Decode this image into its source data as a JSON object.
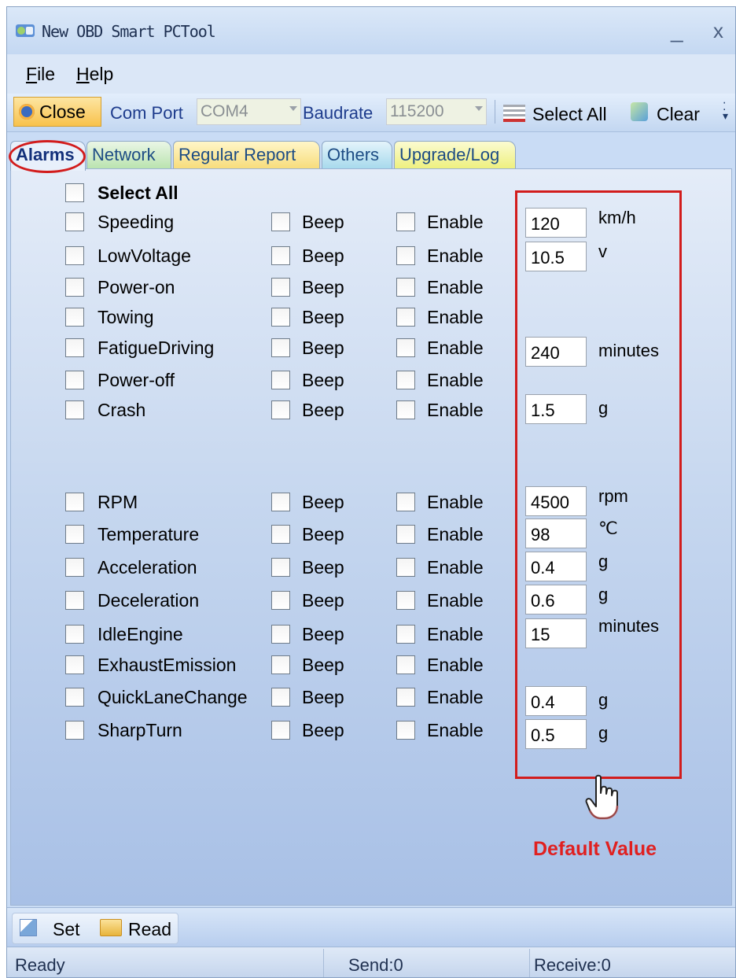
{
  "window": {
    "title": "New OBD Smart PCTool",
    "minimize": "_",
    "close": "x"
  },
  "menu": {
    "file_prefix": "F",
    "file_rest": "ile",
    "help_prefix": "H",
    "help_rest": "elp"
  },
  "toolbar": {
    "connect_label": "Close",
    "com_port_label": "Com Port",
    "com_port_value": "COM4",
    "baudrate_label": "Baudrate",
    "baudrate_value": "115200",
    "select_all_label": "Select All",
    "clear_label": "Clear"
  },
  "tabs": [
    "Alarms",
    "Network",
    "Regular Report",
    "Others",
    "Upgrade/Log"
  ],
  "alarms": {
    "select_all": "Select All",
    "beep_label": "Beep",
    "enable_label": "Enable",
    "items": [
      {
        "name": "Speeding",
        "value": "120",
        "unit": "km/h"
      },
      {
        "name": "LowVoltage",
        "value": "10.5",
        "unit": "v"
      },
      {
        "name": "Power-on"
      },
      {
        "name": "Towing"
      },
      {
        "name": "FatigueDriving",
        "value": "240",
        "unit": "minutes"
      },
      {
        "name": "Power-off"
      },
      {
        "name": "Crash",
        "value": "1.5",
        "unit": "g"
      },
      {
        "name": "RPM",
        "value": "4500",
        "unit": "rpm"
      },
      {
        "name": "Temperature",
        "value": "98",
        "unit": "℃"
      },
      {
        "name": "Acceleration",
        "value": "0.4",
        "unit": "g"
      },
      {
        "name": "Deceleration",
        "value": "0.6",
        "unit": "g"
      },
      {
        "name": "IdleEngine",
        "value": "15",
        "unit": "minutes"
      },
      {
        "name": "ExhaustEmission"
      },
      {
        "name": "QuickLaneChange",
        "value": "0.4",
        "unit": "g"
      },
      {
        "name": "SharpTurn",
        "value": "0.5",
        "unit": "g"
      }
    ]
  },
  "annotation": {
    "label": "Default Value",
    "icon": "pointer-hand-icon",
    "color": "#d21c1c"
  },
  "bottom": {
    "set_label": "Set",
    "read_label": "Read"
  },
  "status": {
    "ready": "Ready",
    "send": "Send:0",
    "receive": "Receive:0"
  }
}
